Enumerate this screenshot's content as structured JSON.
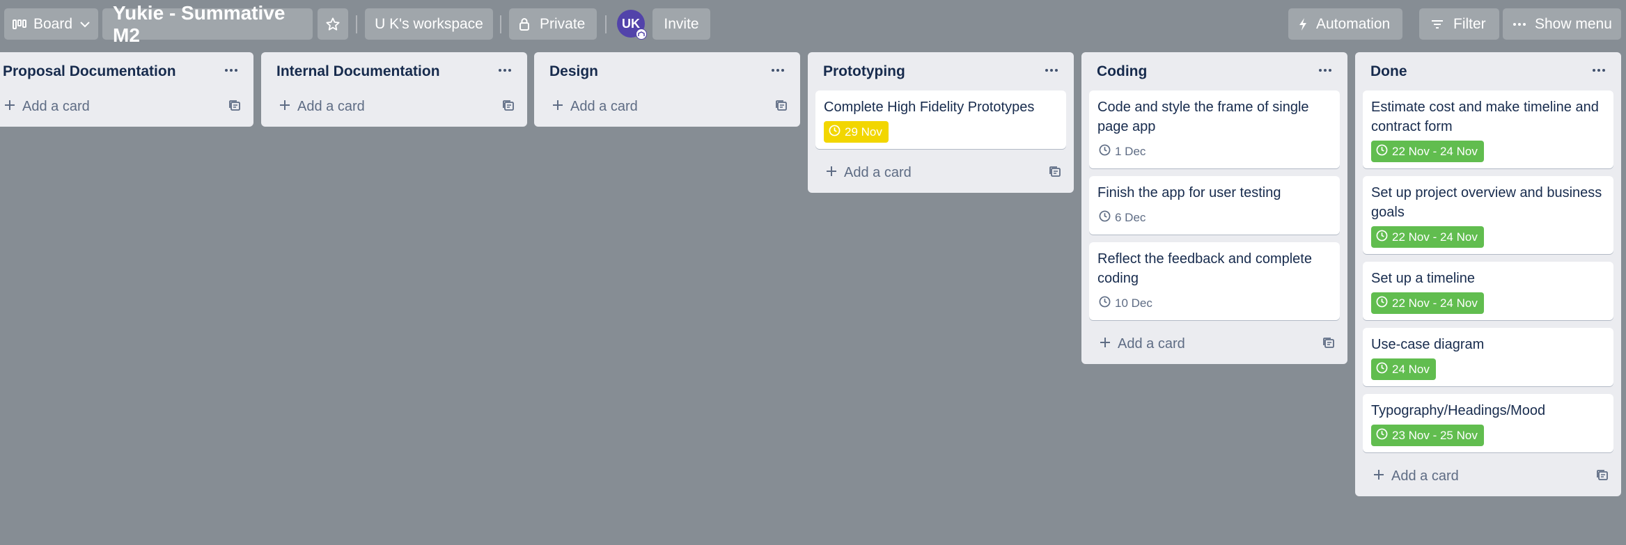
{
  "topbar": {
    "board_view_label": "Board",
    "board_title": "Yukie - Summative M2",
    "workspace_label": "U K's workspace",
    "visibility_label": "Private",
    "avatar_initials": "UK",
    "invite_label": "Invite",
    "automation_label": "Automation",
    "filter_label": "Filter",
    "show_menu_label": "Show menu"
  },
  "add_card_label": "Add a card",
  "colors": {
    "board_bg": "#868d94",
    "list_bg": "#ebecf0",
    "green_badge": "#61bd4f",
    "yellow_badge": "#f2d600",
    "avatar": "#5243aa"
  },
  "lists": [
    {
      "title": "Proposal Documentation",
      "cards": []
    },
    {
      "title": "Internal Documentation",
      "cards": []
    },
    {
      "title": "Design",
      "cards": []
    },
    {
      "title": "Prototyping",
      "cards": [
        {
          "title": "Complete High Fidelity Prototypes",
          "due": "29 Nov",
          "due_style": "yellow"
        }
      ]
    },
    {
      "title": "Coding",
      "cards": [
        {
          "title": "Code and style the frame of single page app",
          "due": "1 Dec",
          "due_style": "plain"
        },
        {
          "title": "Finish the app for user testing",
          "due": "6 Dec",
          "due_style": "plain"
        },
        {
          "title": "Reflect the feedback and complete coding",
          "due": "10 Dec",
          "due_style": "plain"
        }
      ]
    },
    {
      "title": "Done",
      "cards": [
        {
          "title": "Estimate cost and make timeline and contract form",
          "due": "22 Nov - 24 Nov",
          "due_style": "green"
        },
        {
          "title": "Set up project overview and business goals",
          "due": "22 Nov - 24 Nov",
          "due_style": "green"
        },
        {
          "title": "Set up a timeline",
          "due": "22 Nov - 24 Nov",
          "due_style": "green"
        },
        {
          "title": "Use-case diagram",
          "due": "24 Nov",
          "due_style": "green"
        },
        {
          "title": "Typography/Headings/Mood",
          "due": "23 Nov - 25 Nov",
          "due_style": "green"
        }
      ]
    }
  ]
}
